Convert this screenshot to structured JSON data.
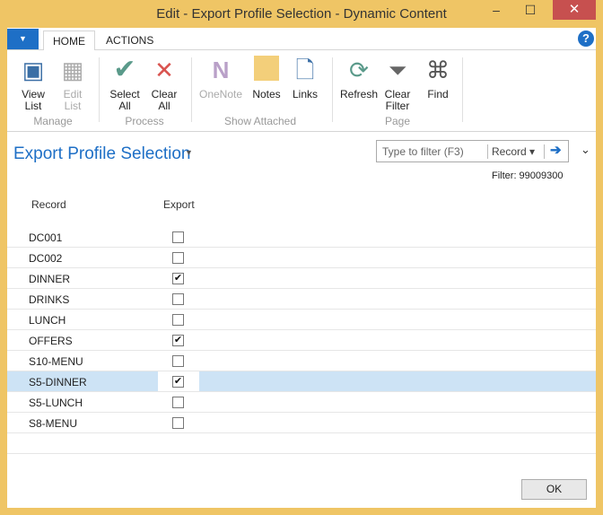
{
  "window": {
    "title": "Edit - Export Profile Selection - Dynamic Content",
    "minimize": "–",
    "maximize": "☐",
    "close": "✕"
  },
  "tabs": {
    "menu": "▼",
    "home": "HOME",
    "actions": "ACTIONS",
    "help": "?"
  },
  "ribbon": {
    "view_list": "View List",
    "edit_list": "Edit List",
    "manage": "Manage",
    "select_all": "Select All",
    "clear_all": "Clear All",
    "process": "Process",
    "onenote": "OneNote",
    "notes": "Notes",
    "links": "Links",
    "show_attached": "Show Attached",
    "refresh": "Refresh",
    "clear_filter": "Clear Filter",
    "find": "Find",
    "page": "Page"
  },
  "page": {
    "title": "Export Profile Selection",
    "filter_placeholder": "Type to filter (F3)",
    "filter_field": "Record ▾",
    "filter_go": "➔",
    "filter_text": "Filter: 99009300",
    "collapse": "⌄"
  },
  "columns": {
    "record": "Record",
    "export": "Export"
  },
  "rows": [
    {
      "record": "DC001",
      "export": false
    },
    {
      "record": "DC002",
      "export": false
    },
    {
      "record": "DINNER",
      "export": true
    },
    {
      "record": "DRINKS",
      "export": false
    },
    {
      "record": "LUNCH",
      "export": false
    },
    {
      "record": "OFFERS",
      "export": true
    },
    {
      "record": "S10-MENU",
      "export": false
    },
    {
      "record": "S5-DINNER",
      "export": true,
      "selected": true
    },
    {
      "record": "S5-LUNCH",
      "export": false
    },
    {
      "record": "S8-MENU",
      "export": false
    }
  ],
  "ok": "OK"
}
